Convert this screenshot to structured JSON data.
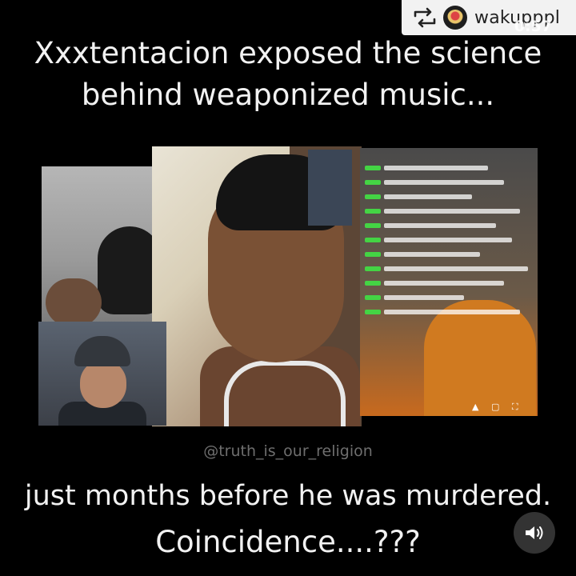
{
  "repost": {
    "username": "wakupppl",
    "icons": {
      "repost": "repost-icon",
      "avatar": "profile-avatar"
    }
  },
  "video": {
    "timer": "0:57",
    "headline_line1": "Xxxtentacion exposed the science",
    "headline_line2": "behind weaponized music...",
    "watermark": "@truth_is_our_religion",
    "footer_line1": "just months before he was murdered.",
    "footer_line2": "Coincidence....???",
    "sound_icon": "speaker-icon"
  }
}
